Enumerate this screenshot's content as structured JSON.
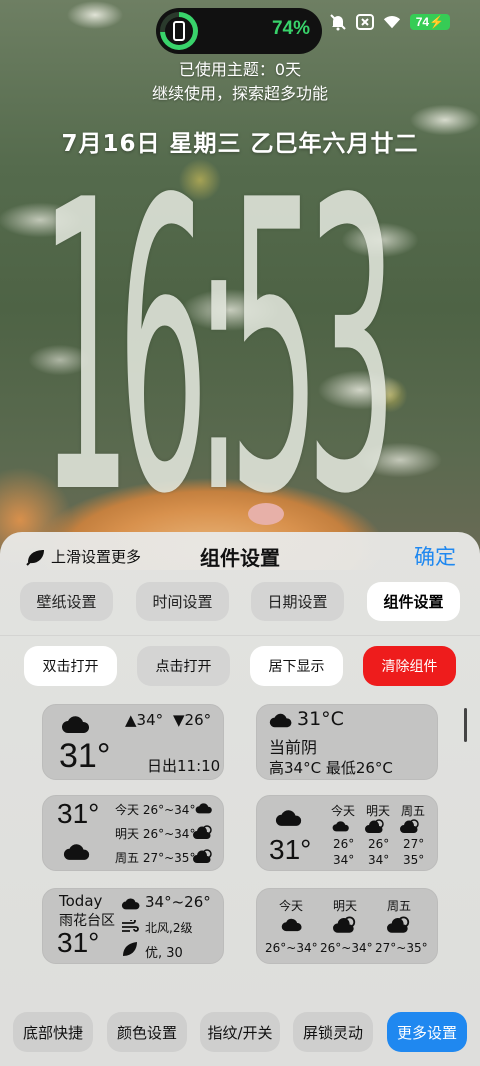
{
  "status": {
    "battery_percent_island": "74%",
    "battery_level": 0.74,
    "battery_badge": "74",
    "icons": [
      "mute-icon",
      "close-box-icon",
      "wifi-icon",
      "battery-icon"
    ]
  },
  "lockscreen": {
    "theme_line1": "已使用主题：0天",
    "theme_line2": "继续使用，探索超多功能",
    "date": "7月16日 星期三 乙巳年六月廿二",
    "time": "16:53"
  },
  "panel": {
    "swipe_hint": "上滑设置更多",
    "title": "组件设置",
    "confirm": "确定",
    "tabs": [
      {
        "label": "壁纸设置"
      },
      {
        "label": "时间设置"
      },
      {
        "label": "日期设置"
      },
      {
        "label": "组件设置"
      }
    ],
    "actions": [
      {
        "label": "双击打开"
      },
      {
        "label": "点击打开"
      },
      {
        "label": "居下显示"
      },
      {
        "label": "清除组件"
      }
    ]
  },
  "widgets": {
    "w1": {
      "high": "▲34°",
      "low": "▼26°",
      "temp": "31°",
      "sunrise": "日出11:10"
    },
    "w2": {
      "temp": "31°C",
      "cond": "当前阴",
      "range": "高34°C  最低26°C"
    },
    "w3": {
      "temp": "31°",
      "rows": [
        {
          "day": "今天",
          "range": "26°~34°"
        },
        {
          "day": "明天",
          "range": "26°~34°"
        },
        {
          "day": "周五",
          "range": "27°~35°"
        }
      ]
    },
    "w4": {
      "temp": "31°",
      "days": [
        {
          "day": "今天",
          "low": "26°",
          "high": "34°"
        },
        {
          "day": "明天",
          "low": "26°",
          "high": "34°"
        },
        {
          "day": "周五",
          "low": "27°",
          "high": "35°"
        }
      ]
    },
    "w5": {
      "today": "Today",
      "district": "雨花台区",
      "temp": "31°",
      "range": "34°~26°",
      "wind": "北风,2级",
      "aqi": "优, 30"
    },
    "w6": {
      "days": [
        {
          "day": "今天",
          "range": "26°~34°"
        },
        {
          "day": "明天",
          "range": "26°~34°"
        },
        {
          "day": "周五",
          "range": "27°~35°"
        }
      ]
    }
  },
  "bottom_bar": [
    {
      "label": "底部快捷"
    },
    {
      "label": "颜色设置"
    },
    {
      "label": "指纹/开关"
    },
    {
      "label": "屏锁灵动"
    },
    {
      "label": "更多设置"
    }
  ]
}
